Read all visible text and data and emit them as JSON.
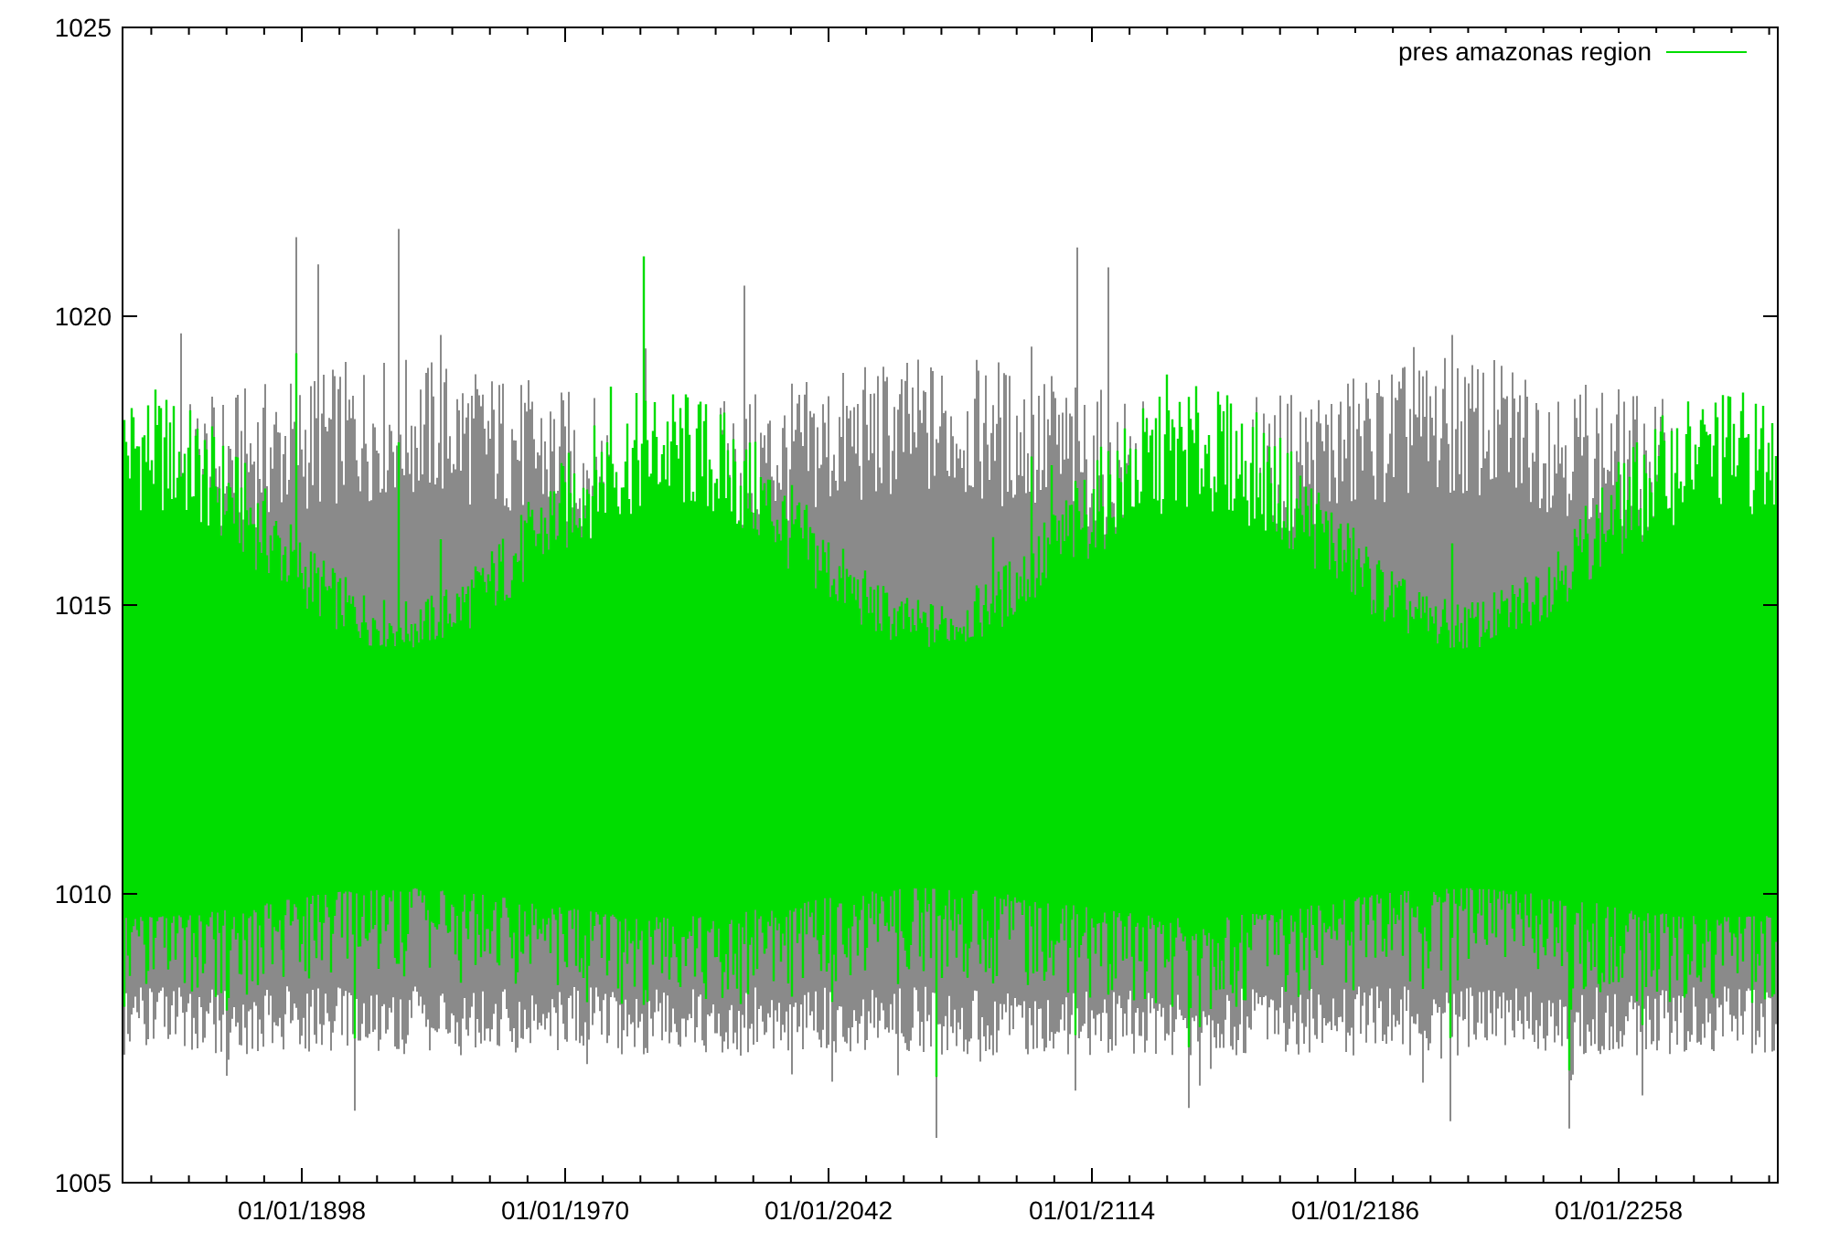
{
  "chart": {
    "legend": {
      "label": "pres amazonas region"
    },
    "y_tick_labels": [
      "1025",
      "1020",
      "1015",
      "1010",
      "1005"
    ],
    "x_tick_labels": [
      "01/01/1898",
      "01/01/1970",
      "01/01/2042",
      "01/01/2114",
      "01/01/2186",
      "01/01/2258"
    ]
  }
}
